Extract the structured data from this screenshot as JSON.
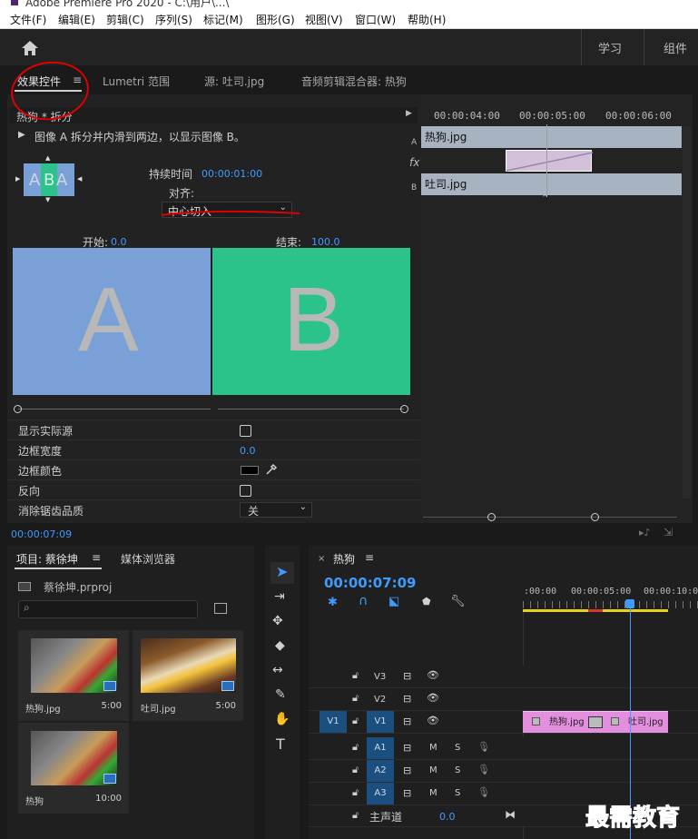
{
  "titlebar": {
    "text": "Adobe Premiere Pro 2020 - C:\\用户\\...\\"
  },
  "menu": [
    "文件(F)",
    "编辑(E)",
    "剪辑(C)",
    "序列(S)",
    "标记(M)",
    "图形(G)",
    "视图(V)",
    "窗口(W)",
    "帮助(H)"
  ],
  "workspaces": [
    "学习",
    "组件"
  ],
  "panel_tabs": {
    "effect_controls": "效果控件",
    "lumetri": "Lumetri 范围",
    "source": "源: 吐司.jpg",
    "audio_mixer": "音频剪辑混合器: 热狗"
  },
  "effect_controls": {
    "clip_header": "热狗 * 拆分",
    "description": "图像 A 拆分并内滑到两边，以显示图像 B。",
    "duration_label": "持续时间",
    "duration_value": "00:00:01:00",
    "align_label": "对齐:",
    "align_value": "中心切入",
    "start_label": "开始:",
    "start_value": "0.0",
    "end_label": "结束:",
    "end_value": "100.0",
    "preview_a": "A",
    "preview_b": "B",
    "thumb_a": "A",
    "thumb_b": "B",
    "props": [
      {
        "label": "显示实际源",
        "type": "checkbox"
      },
      {
        "label": "边框宽度",
        "type": "value",
        "value": "0.0"
      },
      {
        "label": "边框颜色",
        "type": "color"
      },
      {
        "label": "反向",
        "type": "checkbox"
      },
      {
        "label": "消除锯齿品质",
        "type": "dropdown",
        "value": "关"
      }
    ],
    "timecode": "00:00:07:09",
    "mini_timeline": {
      "ticks": [
        "00:00:04:00",
        "00:00:05:00",
        "00:00:06:00"
      ],
      "track_a_label": "A",
      "track_b_label": "B",
      "fx_label": "fx",
      "clip_a": "热狗.jpg",
      "clip_b": "吐司.jpg"
    }
  },
  "project": {
    "tab": "项目: 蔡徐坤",
    "tab2": "媒体浏览器",
    "file": "蔡徐坤.prproj",
    "items": [
      {
        "name": "热狗.jpg",
        "duration": "5:00"
      },
      {
        "name": "吐司.jpg",
        "duration": "5:00"
      },
      {
        "name": "热狗",
        "duration": "10:00"
      }
    ]
  },
  "timeline": {
    "tab": "热狗",
    "timecode": "00:00:07:09",
    "ruler": [
      ":00:00",
      "00:00:05:00",
      "00:00:10:00"
    ],
    "video_tracks": [
      "V3",
      "V2",
      "V1"
    ],
    "source_patch": "V1",
    "audio_tracks": [
      "A1",
      "A2",
      "A3"
    ],
    "m": "M",
    "s": "S",
    "master_label": "主声道",
    "master_value": "0.0",
    "clip1": "热狗.jpg",
    "clip2": "吐司.jpg"
  },
  "watermark": "最需教育",
  "colors": {
    "accent_blue": "#3f9bff",
    "preview_a_bg": "#7aa0d8",
    "preview_b_bg": "#2bc389",
    "clip_pink": "#e48ee0",
    "annotation_red": "#e00000"
  }
}
